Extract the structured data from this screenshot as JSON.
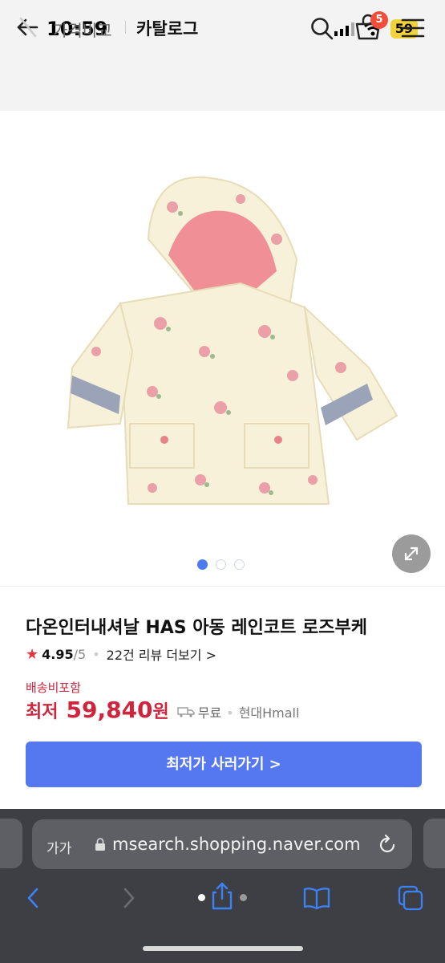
{
  "status": {
    "time": "10:59",
    "battery": "59"
  },
  "nav": {
    "price_compare": "가격비교",
    "catalog": "카탈로그",
    "cart_count": "5"
  },
  "gallery": {
    "image_description": "product photo: cream floral hooded raincoat",
    "page_count": 3,
    "active_page": 1
  },
  "product": {
    "title": "다온인터내셔날 HAS 아동 레인코트 로즈부케",
    "rating": "4.95",
    "rating_max": "/5",
    "reviews": "22건 리뷰 더보기 >",
    "shipping_label": "배송비포함",
    "price_lowest_label": "최저",
    "price": "59,840",
    "price_unit": "원",
    "delivery": "무료",
    "mall": "현대Hmall",
    "buy_button": "최저가 사러가기 >"
  },
  "browser": {
    "aa_label": "가가",
    "url": "msearch.shopping.naver.com"
  },
  "colors": {
    "accent": "#5578f0",
    "price_red": "#d0243c",
    "badge": "#f24e3c"
  }
}
